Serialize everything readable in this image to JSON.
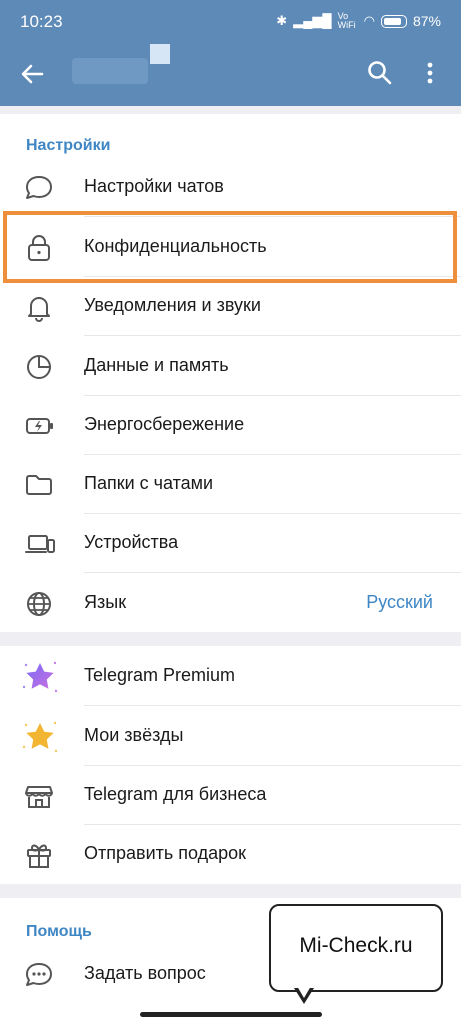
{
  "status_bar": {
    "time": "10:23",
    "network": "Vo WiFi",
    "battery": "87%"
  },
  "settings_section": {
    "header": "Настройки",
    "items": [
      {
        "label": "Настройки чатов",
        "icon": "chat-bubble-icon"
      },
      {
        "label": "Конфиденциальность",
        "icon": "lock-icon"
      },
      {
        "label": "Уведомления и звуки",
        "icon": "bell-icon"
      },
      {
        "label": "Данные и память",
        "icon": "pie-chart-icon"
      },
      {
        "label": "Энергосбережение",
        "icon": "battery-icon"
      },
      {
        "label": "Папки с чатами",
        "icon": "folder-icon"
      },
      {
        "label": "Устройства",
        "icon": "devices-icon"
      },
      {
        "label": "Язык",
        "value": "Русский",
        "icon": "globe-icon"
      }
    ]
  },
  "premium_section": {
    "items": [
      {
        "label": "Telegram Premium",
        "icon": "premium-star-icon"
      },
      {
        "label": "Мои звёзды",
        "icon": "gold-star-icon"
      },
      {
        "label": "Telegram для бизнеса",
        "icon": "shop-icon"
      },
      {
        "label": "Отправить подарок",
        "icon": "gift-icon"
      }
    ]
  },
  "help_section": {
    "header": "Помощь",
    "items": [
      {
        "label": "Задать вопрос",
        "icon": "chat-dots-icon"
      }
    ]
  },
  "watermark": {
    "text": "Mi-Check.ru"
  },
  "colors": {
    "header_bg": "#5e8ab7",
    "accent": "#3f86c4",
    "highlight": "#ef8e3b"
  }
}
